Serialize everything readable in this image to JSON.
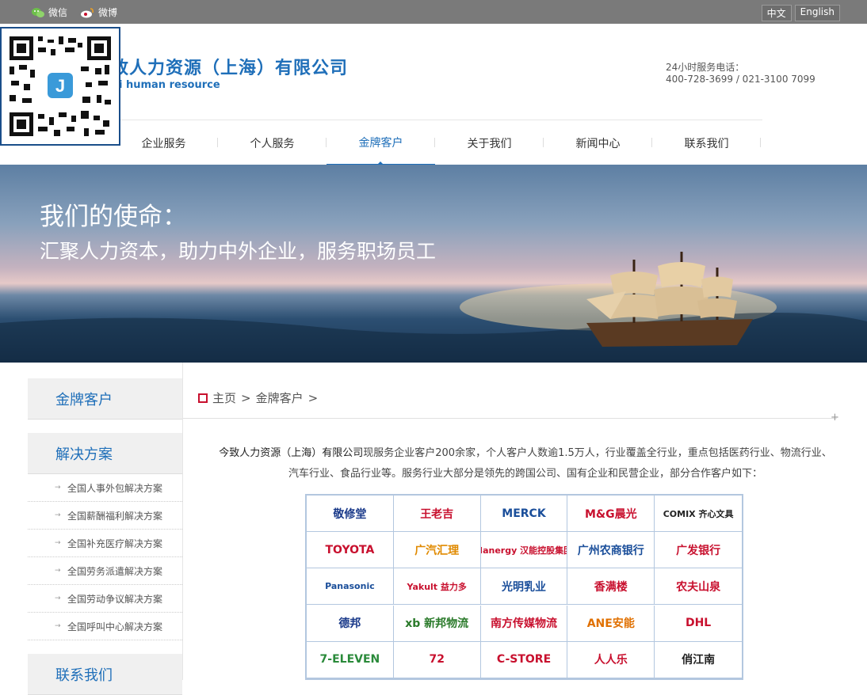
{
  "topbar": {
    "wechat_label": "微信",
    "weibo_label": "微博",
    "lang_cn": "中文",
    "lang_en": "English"
  },
  "header": {
    "company_name": "致人力资源（上海）有限公司",
    "company_en": "i human resource",
    "hotline_label": "24小时服务电话：",
    "hotline_numbers": "400-728-3699 / 021-3100 7099"
  },
  "nav": {
    "items": [
      {
        "label": "企业服务"
      },
      {
        "label": "个人服务"
      },
      {
        "label": "金牌客户"
      },
      {
        "label": "关于我们"
      },
      {
        "label": "新闻中心"
      },
      {
        "label": "联系我们"
      }
    ]
  },
  "banner": {
    "title": "我们的使命：",
    "subtitle": "汇聚人力资本，助力中外企业，服务职场员工"
  },
  "sidebar": {
    "section1_title": "金牌客户",
    "section2_title": "解决方案",
    "solutions": [
      {
        "label": "全国人事外包解决方案"
      },
      {
        "label": "全国薪酬福利解决方案"
      },
      {
        "label": "全国补充医疗解决方案"
      },
      {
        "label": "全国劳务派遣解决方案"
      },
      {
        "label": "全国劳动争议解决方案"
      },
      {
        "label": "全国呼叫中心解决方案"
      }
    ],
    "section3_title": "联系我们"
  },
  "breadcrumb": {
    "home": "主页",
    "sep1": ">",
    "current": "金牌客户",
    "sep2": ">"
  },
  "intro": {
    "company": "今致人力资源（上海）有限公司",
    "text": "现服务企业客户200余家，个人客户人数逾1.5万人，行业覆盖全行业，重点包括医药行业、物流行业、汽车行业、食品行业等。服务行业大部分是领先的跨国公司、国有企业和民营企业，部分合作客户如下："
  },
  "clients": [
    {
      "name": "敬修堂",
      "color": "#1a3a8a"
    },
    {
      "name": "王老吉",
      "color": "#c8102e"
    },
    {
      "name": "MERCK",
      "color": "#1a4e9a"
    },
    {
      "name": "M&G晨光",
      "color": "#c8102e"
    },
    {
      "name": "COMIX 齐心文具",
      "color": "#222222"
    },
    {
      "name": "TOYOTA",
      "color": "#c8102e"
    },
    {
      "name": "广汽汇理",
      "color": "#e08a00"
    },
    {
      "name": "Hanergy 汉能控股集团",
      "color": "#c8102e"
    },
    {
      "name": "广州农商银行",
      "color": "#1a4e9a"
    },
    {
      "name": "广发银行",
      "color": "#c8102e"
    },
    {
      "name": "Panasonic",
      "color": "#1a4e9a"
    },
    {
      "name": "Yakult 益力多",
      "color": "#c8102e"
    },
    {
      "name": "光明乳业",
      "color": "#1a4e9a"
    },
    {
      "name": "香满楼",
      "color": "#c8102e"
    },
    {
      "name": "农夫山泉",
      "color": "#c8102e"
    },
    {
      "name": "德邦",
      "color": "#1a3a8a"
    },
    {
      "name": "xb 新邦物流",
      "color": "#2a7a2a"
    },
    {
      "name": "南方传媒物流",
      "color": "#c8102e"
    },
    {
      "name": "ANE安能",
      "color": "#e07000"
    },
    {
      "name": "DHL",
      "color": "#c8102e"
    },
    {
      "name": "7-ELEVEN",
      "color": "#2a8a3a"
    },
    {
      "name": "72",
      "color": "#c8102e"
    },
    {
      "name": "C-STORE",
      "color": "#c8102e"
    },
    {
      "name": "人人乐",
      "color": "#c8102e"
    },
    {
      "name": "俏江南",
      "color": "#222222"
    }
  ]
}
